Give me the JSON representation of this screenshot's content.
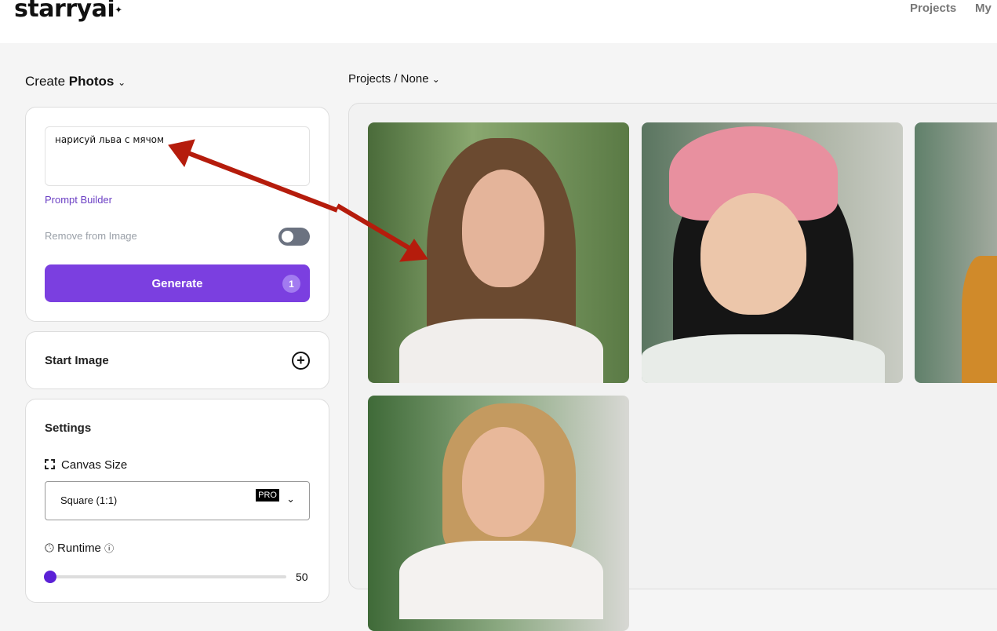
{
  "header": {
    "logo": "starryai",
    "nav": [
      "Projects",
      "My"
    ]
  },
  "sidebar": {
    "create_prefix": "Create",
    "create_mode": "Photos",
    "prompt": {
      "value": "нарисуй льва с мячом"
    },
    "prompt_builder": "Prompt Builder",
    "remove_from_image": {
      "label": "Remove from Image",
      "enabled": false
    },
    "generate": {
      "label": "Generate",
      "count": "1"
    },
    "start_image": "Start Image",
    "settings": {
      "title": "Settings",
      "canvas_size_label": "Canvas Size",
      "canvas_size_value": "Square (1:1)",
      "pro_badge": "PRO",
      "runtime_label": "Runtime",
      "runtime_value": "50"
    }
  },
  "main": {
    "breadcrumb": "Projects / None"
  },
  "colors": {
    "accent": "#7b3fe0",
    "link": "#6b3fc4",
    "annotation_arrow": "#b51c0c"
  }
}
